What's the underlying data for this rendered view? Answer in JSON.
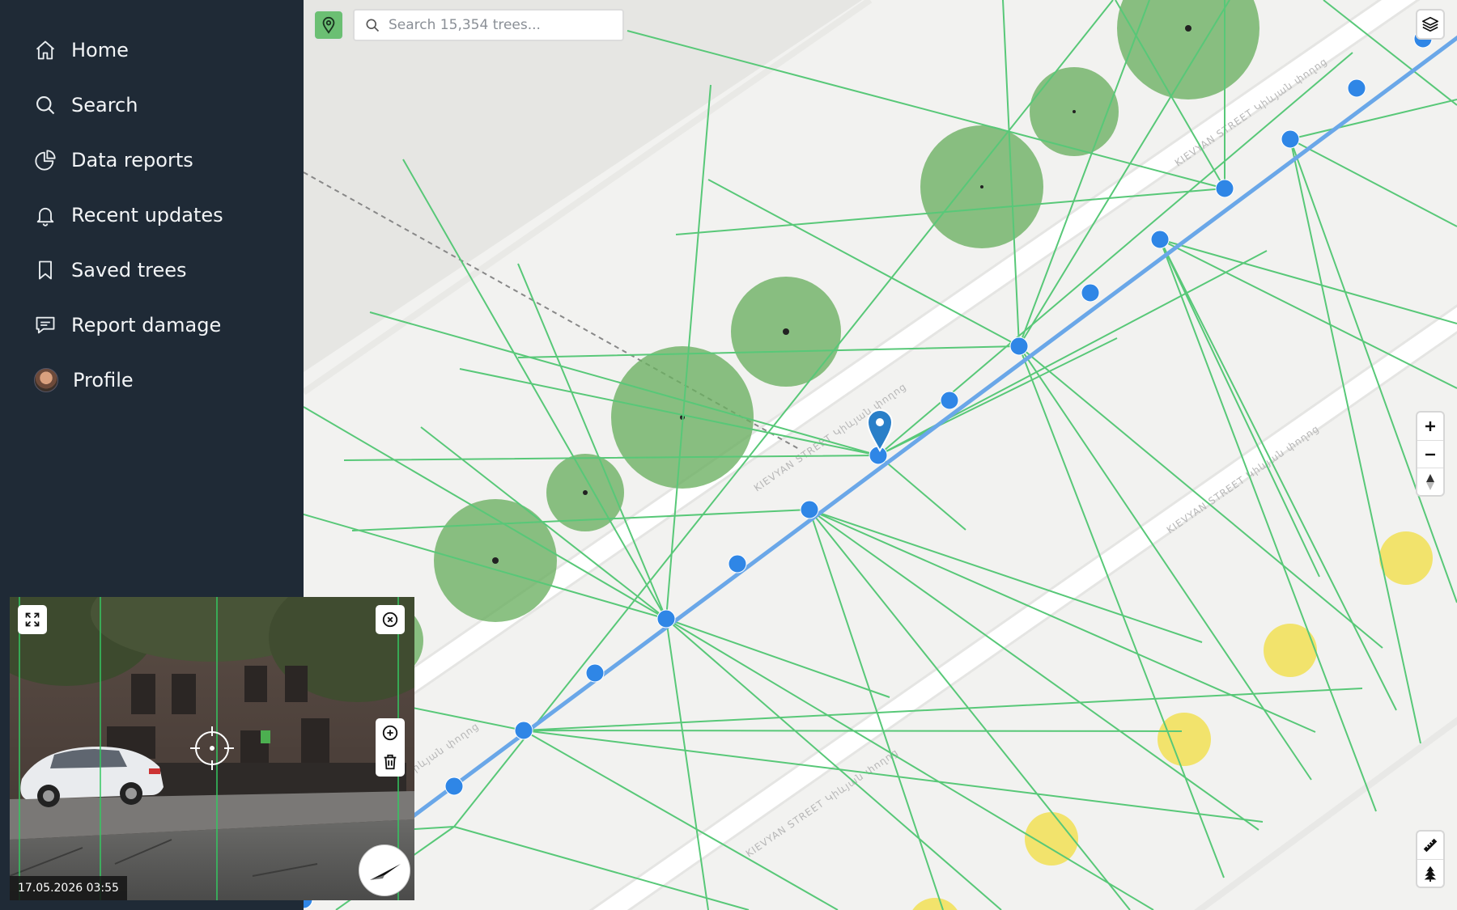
{
  "sidebar": {
    "items": [
      {
        "label": "Home",
        "icon": "home-icon"
      },
      {
        "label": "Search",
        "icon": "search-icon"
      },
      {
        "label": "Data reports",
        "icon": "pie-chart-icon"
      },
      {
        "label": "Recent updates",
        "icon": "bell-icon"
      },
      {
        "label": "Saved trees",
        "icon": "bookmark-icon"
      },
      {
        "label": "Report damage",
        "icon": "message-icon"
      },
      {
        "label": "Profile",
        "icon": "avatar"
      }
    ]
  },
  "map": {
    "search_placeholder": "Search 15,354 trees...",
    "street_label": "KIEVYAN STREET Կիևյան փողոց",
    "street_label_short": "Կիևյան փողոց",
    "colors": {
      "tree_canopy": "#6aaf60",
      "tree_highlight": "#f2e155",
      "sightline": "#58c878",
      "track": "#6aa7e8",
      "track_point": "#2f86e6",
      "marker": "#2a7fc8",
      "road": "#ffffff",
      "land": "#f2f2f0",
      "building": "#e6e6e3"
    },
    "icons": [
      "map-pin-icon",
      "search-icon",
      "layers-icon",
      "plus-icon",
      "minus-icon",
      "compass-north-icon",
      "ruler-icon",
      "tree-icon"
    ]
  },
  "streetview": {
    "timestamp": "17.05.2026 03:55",
    "icons": [
      "expand-icon",
      "close-circle-icon",
      "add-circle-icon",
      "trash-icon",
      "crosshair-icon",
      "compass-needle-icon"
    ]
  }
}
